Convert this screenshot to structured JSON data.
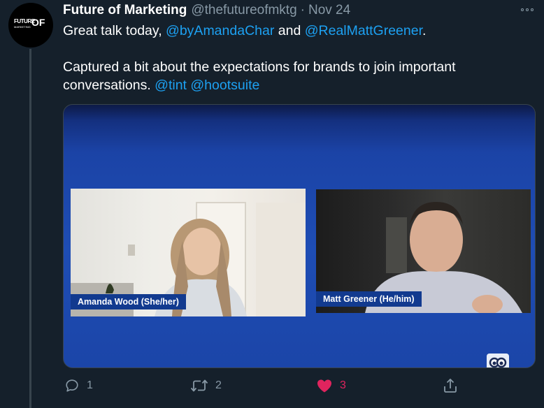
{
  "tweet": {
    "author_name": "Future of Marketing",
    "handle": "@thefutureofmktg",
    "separator": "·",
    "date": "Nov 24",
    "avatar_logo": {
      "line1": "FUTURE",
      "line2": "MARKETING",
      "line3": "OF"
    },
    "line1": {
      "prefix": "Great talk today, ",
      "mention1": "@byAmandaChar",
      "middle": " and ",
      "mention2": "@RealMattGreener",
      "suffix": "."
    },
    "line2": "Captured a bit about the expectations for brands to join important",
    "line3": {
      "prefix": "conversations. ",
      "mention1": "@tint",
      "mention2": "@hootsuite"
    },
    "media": {
      "participant1_label": "Amanda Wood (She/her)",
      "participant2_label": "Matt Greener (He/him)",
      "watermark": "hootsuite-owl-logo"
    },
    "actions": {
      "reply_count": "1",
      "retweet_count": "2",
      "like_count": "3",
      "liked": true
    }
  },
  "colors": {
    "background": "#15202b",
    "link": "#1da1f2",
    "secondary_text": "#8899a6",
    "like": "#e0245e",
    "media_blue": "#1e4db4"
  },
  "icons": [
    "more-icon",
    "reply-icon",
    "retweet-icon",
    "heart-icon",
    "share-icon"
  ]
}
